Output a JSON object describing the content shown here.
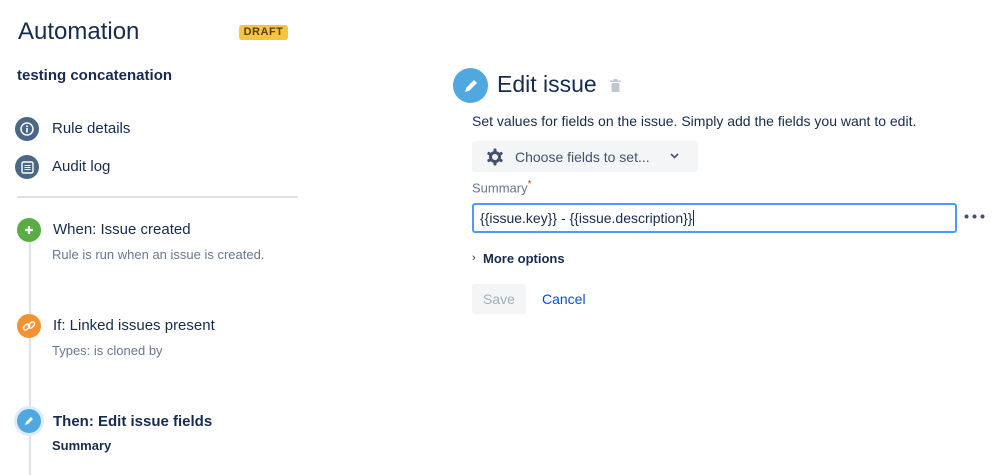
{
  "sidebar": {
    "title": "Automation",
    "badge": "DRAFT",
    "rule_name": "testing concatenation",
    "nav": [
      {
        "label": "Rule details",
        "icon": "info-icon"
      },
      {
        "label": "Audit log",
        "icon": "list-icon"
      }
    ],
    "steps": [
      {
        "title": "When: Issue created",
        "detail": "Rule is run when an issue is created.",
        "icon": "plus-icon",
        "color": "#5AAC44"
      },
      {
        "title": "If: Linked issues present",
        "detail": "Types: is cloned by",
        "icon": "link-icon",
        "color": "#F79232"
      },
      {
        "title": "Then: Edit issue fields",
        "detail": "Summary",
        "icon": "pencil-icon",
        "color": "#4FA8DF"
      }
    ]
  },
  "editor": {
    "title": "Edit issue",
    "description": "Set values for fields on the issue. Simply add the fields you want to edit.",
    "choose_fields": "Choose fields to set...",
    "field_label": "Summary",
    "required_mark": "*",
    "field_value": "{{issue.key}} - {{issue.description}}",
    "more_options": "More options",
    "save": "Save",
    "cancel": "Cancel"
  }
}
